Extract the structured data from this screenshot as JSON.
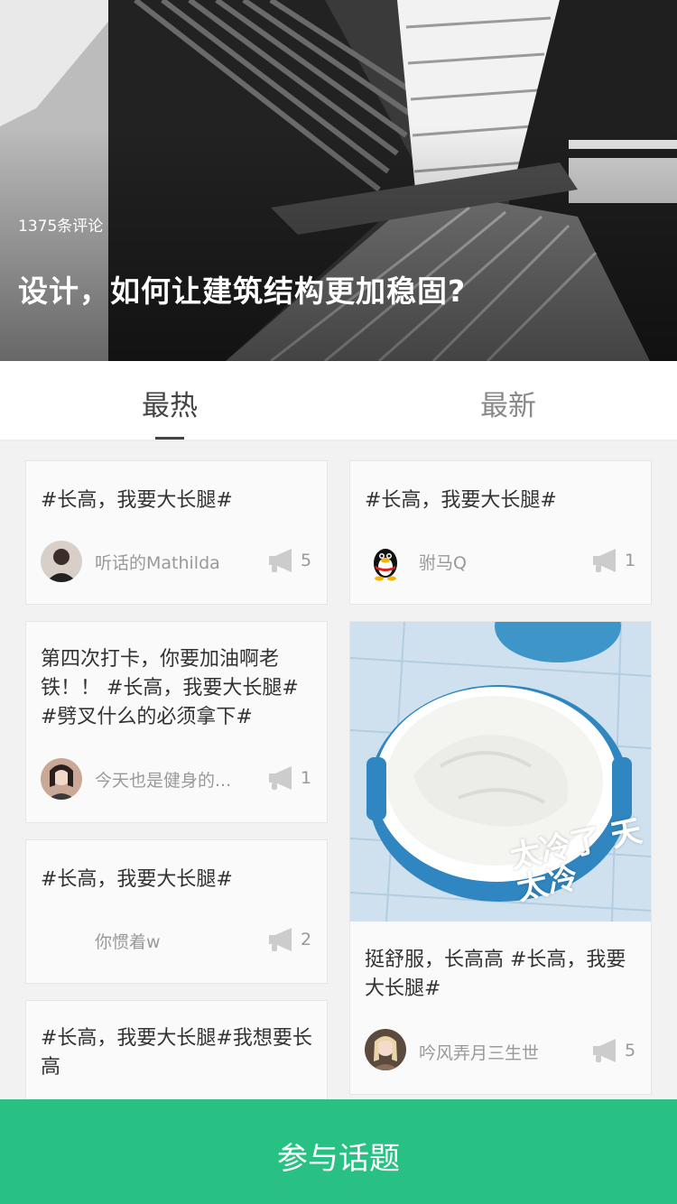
{
  "hero": {
    "comment_count": "1375条评论",
    "title": "设计，如何让建筑结构更加稳固?"
  },
  "tabs": [
    {
      "label": "最热",
      "active": true
    },
    {
      "label": "最新",
      "active": false
    }
  ],
  "cards_left": [
    {
      "text": "#长高，我要大长腿#",
      "author": "听话的Mathilda",
      "likes": "5"
    },
    {
      "text": "第四次打卡，你要加油啊老铁！！ #长高，我要大长腿# #劈叉什么的必须拿下#",
      "author": "今天也是健身的...",
      "likes": "1"
    },
    {
      "text": "#长高，我要大长腿#",
      "author": "你惯着w",
      "likes": "2"
    },
    {
      "text": "#长高，我要大长腿#我想要长高",
      "author": "",
      "likes": ""
    }
  ],
  "cards_right": [
    {
      "text": "#长高，我要大长腿#",
      "author": "驸马Q",
      "likes": "1"
    },
    {
      "text": "挺舒服，长高高 #长高，我要大长腿#",
      "author": "吟风弄月三生世",
      "likes": "5",
      "image_sticker": "太冷了 天太冷"
    }
  ],
  "join_button": {
    "label": "参与话题"
  },
  "colors": {
    "accent": "#28c183",
    "tab_text": "#444444",
    "meta_text": "#999999"
  },
  "icons": {
    "like": "megaphone-icon"
  }
}
